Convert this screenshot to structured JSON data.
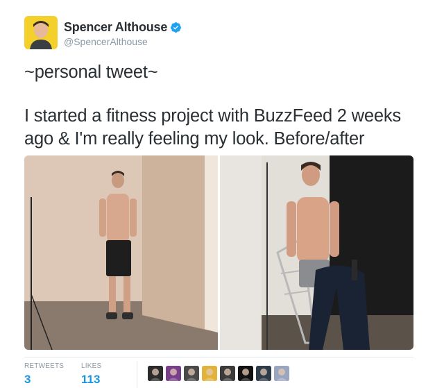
{
  "user": {
    "display_name": "Spencer Althouse",
    "handle": "@SpencerAlthouse",
    "verified": true,
    "avatar_bg": "#f3d02c",
    "verified_color": "#1da1f2"
  },
  "tweet": {
    "line1": "~personal tweet~",
    "body": "I started a fitness project with BuzzFeed 2 weeks ago & I'm really feeling my look. Before/after"
  },
  "media": {
    "description_icon": "photo-icon"
  },
  "stats": {
    "retweets_label": "RETWEETS",
    "retweets_value": "3",
    "likes_label": "LIKES",
    "likes_value": "113",
    "accent": "#1b95e0"
  },
  "likers": [
    {
      "name": "liker-1",
      "color": "#2b2b2b"
    },
    {
      "name": "liker-2",
      "color": "#7a3f8a"
    },
    {
      "name": "liker-3",
      "color": "#4a4a4a"
    },
    {
      "name": "liker-4",
      "color": "#e0b33a"
    },
    {
      "name": "liker-5",
      "color": "#3a3a3a"
    },
    {
      "name": "liker-6",
      "color": "#111111"
    },
    {
      "name": "liker-7",
      "color": "#2e3c4a"
    },
    {
      "name": "liker-8",
      "color": "#9aa6c0"
    }
  ]
}
